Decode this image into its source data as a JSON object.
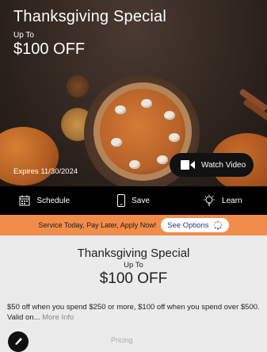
{
  "hero": {
    "title": "Thanksgiving Special",
    "up_to": "Up To",
    "amount": "$100 OFF",
    "expires": "Expires 11/30/2024",
    "watch_label": "Watch Video"
  },
  "actions": [
    {
      "label": "Schedule",
      "icon": "calendar-icon"
    },
    {
      "label": "Save",
      "icon": "phone-icon"
    },
    {
      "label": "Learn",
      "icon": "lightbulb-icon"
    }
  ],
  "promo": {
    "text": "Service Today, Pay Later, Apply Now!",
    "button_label": "See Options",
    "color": "#f18d4a"
  },
  "offer": {
    "title": "Thanksgiving Special",
    "up_to": "Up To",
    "amount": "$100 OFF",
    "description": "$50 off when you spend $250 or more, $100 off when you spend over $500. Valid on...",
    "more_label": "More Info",
    "partial_text": "Pricing"
  }
}
